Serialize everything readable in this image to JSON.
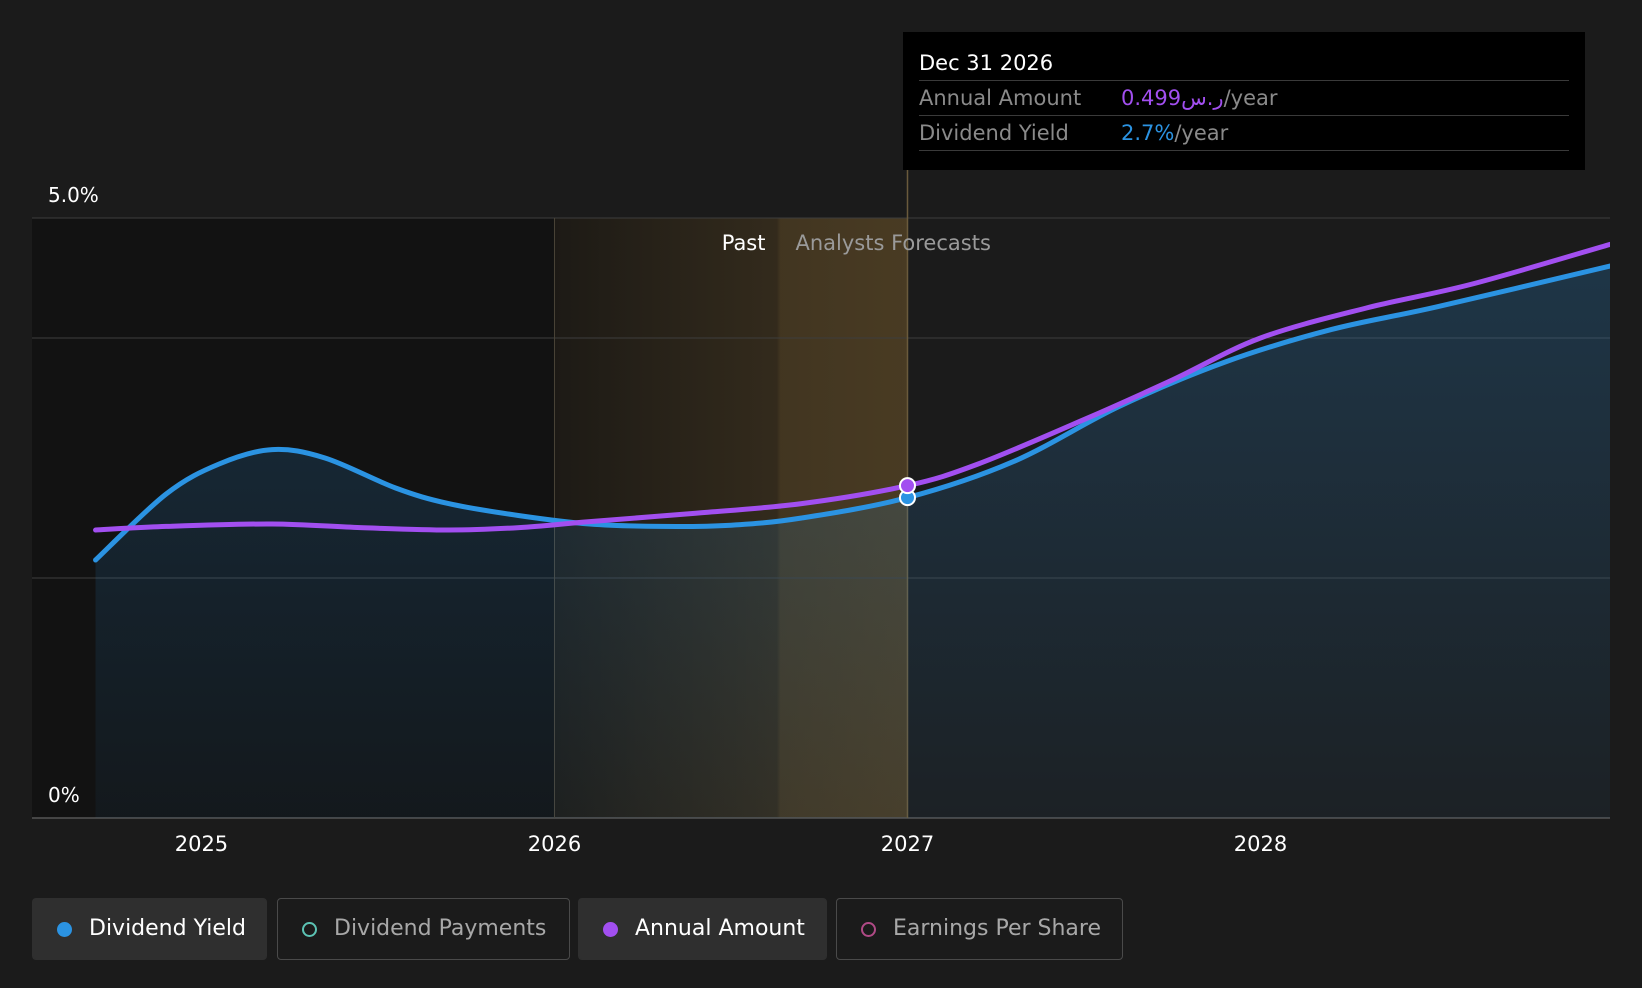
{
  "colors": {
    "background": "#1b1b1b",
    "past_region": "#121212",
    "dividend_yield": "#2b93e2",
    "annual_amount": "#a24ff0",
    "dividend_payments": "#5cc3b4",
    "earnings_per_share": "#b04a86",
    "forecast_band": "#c99a4a"
  },
  "chart_data": {
    "type": "line",
    "x_ticks": [
      "2025",
      "2026",
      "2027",
      "2028"
    ],
    "y_tick_labels": [
      "5.0%",
      "0%"
    ],
    "ylim": [
      0,
      5
    ],
    "xlim": [
      2024.52,
      2028.99
    ],
    "gridlines_pct": [
      0,
      2,
      4,
      5
    ],
    "region_labels": {
      "past": "Past",
      "forecast": "Analysts Forecasts"
    },
    "past_start": 2024.52,
    "highlight_band": [
      2026.0,
      2027.0
    ],
    "marker_x": 2027.0,
    "series": [
      {
        "name": "Dividend Yield",
        "color": "#2b93e2",
        "filled": true,
        "points": [
          [
            2024.7,
            2.15
          ],
          [
            2024.9,
            2.7
          ],
          [
            2025.05,
            2.95
          ],
          [
            2025.2,
            3.07
          ],
          [
            2025.35,
            3.0
          ],
          [
            2025.55,
            2.75
          ],
          [
            2025.7,
            2.62
          ],
          [
            2025.9,
            2.52
          ],
          [
            2026.1,
            2.45
          ],
          [
            2026.3,
            2.43
          ],
          [
            2026.5,
            2.44
          ],
          [
            2026.7,
            2.5
          ],
          [
            2027.0,
            2.67
          ],
          [
            2027.3,
            2.97
          ],
          [
            2027.6,
            3.43
          ],
          [
            2027.9,
            3.8
          ],
          [
            2028.2,
            4.07
          ],
          [
            2028.5,
            4.26
          ],
          [
            2028.99,
            4.6
          ]
        ]
      },
      {
        "name": "Annual Amount",
        "color": "#a24ff0",
        "filled": false,
        "points": [
          [
            2024.7,
            2.4
          ],
          [
            2024.9,
            2.43
          ],
          [
            2025.2,
            2.45
          ],
          [
            2025.45,
            2.42
          ],
          [
            2025.7,
            2.4
          ],
          [
            2025.9,
            2.42
          ],
          [
            2026.1,
            2.47
          ],
          [
            2026.4,
            2.54
          ],
          [
            2026.7,
            2.62
          ],
          [
            2027.0,
            2.77
          ],
          [
            2027.2,
            2.95
          ],
          [
            2027.5,
            3.32
          ],
          [
            2027.75,
            3.65
          ],
          [
            2028.0,
            4.0
          ],
          [
            2028.3,
            4.25
          ],
          [
            2028.6,
            4.45
          ],
          [
            2028.99,
            4.78
          ]
        ]
      }
    ]
  },
  "tooltip": {
    "date": "Dec 31 2026",
    "rows": [
      {
        "label": "Annual Amount",
        "value": "0.499ر.س",
        "unit": "/year",
        "color": "#a24ff0"
      },
      {
        "label": "Dividend Yield",
        "value": "2.7%",
        "unit": "/year",
        "color": "#2b93e2"
      }
    ]
  },
  "legend": [
    {
      "label": "Dividend Yield",
      "color": "#2b93e2",
      "active": true
    },
    {
      "label": "Dividend Payments",
      "color": "#5cc3b4",
      "active": false
    },
    {
      "label": "Annual Amount",
      "color": "#a24ff0",
      "active": true
    },
    {
      "label": "Earnings Per Share",
      "color": "#b04a86",
      "active": false
    }
  ]
}
